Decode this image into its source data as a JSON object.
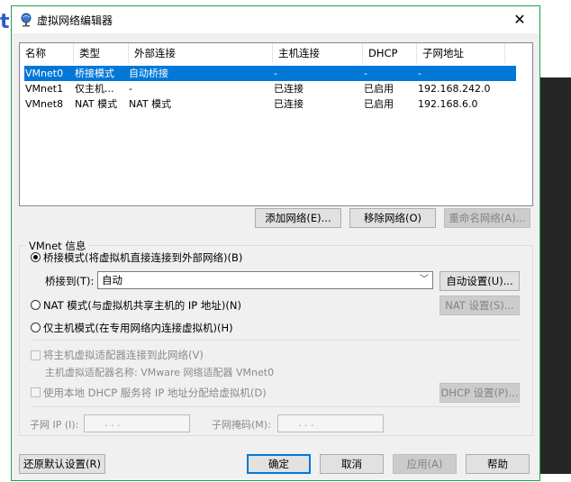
{
  "background": {
    "partial_letter": "t"
  },
  "dialog": {
    "title": "虚拟网络编辑器",
    "close_glyph": "✕"
  },
  "network_list": {
    "columns": [
      "名称",
      "类型",
      "外部连接",
      "主机连接",
      "DHCP",
      "子网地址"
    ],
    "rows": [
      {
        "name": "VMnet0",
        "type": "桥接模式",
        "external": "自动桥接",
        "host": "-",
        "dhcp": "-",
        "subnet": "-",
        "selected": true
      },
      {
        "name": "VMnet1",
        "type": "仅主机...",
        "external": "-",
        "host": "已连接",
        "dhcp": "已启用",
        "subnet": "192.168.242.0",
        "selected": false
      },
      {
        "name": "VMnet8",
        "type": "NAT 模式",
        "external": "NAT 模式",
        "host": "已连接",
        "dhcp": "已启用",
        "subnet": "192.168.6.0",
        "selected": false
      }
    ]
  },
  "list_buttons": {
    "add": "添加网络(E)...",
    "remove": "移除网络(O)",
    "rename": "重命名网络(A)..."
  },
  "vmnet_info": {
    "group_title": "VMnet 信息",
    "bridged_label": "桥接模式(将虚拟机直接连接到外部网络)(B)",
    "bridge_to_label": "桥接到(T):",
    "bridge_to_value": "自动",
    "auto_settings": "自动设置(U)...",
    "nat_label": "NAT 模式(与虚拟机共享主机的 IP 地址)(N)",
    "nat_settings": "NAT 设置(S)...",
    "hostonly_label": "仅主机模式(在专用网络内连接虚拟机)(H)",
    "connect_adapter_label": "将主机虚拟适配器连接到此网络(V)",
    "adapter_name_label": "主机虚拟适配器名称: VMware 网络适配器 VMnet0",
    "dhcp_label": "使用本地 DHCP 服务将 IP 地址分配给虚拟机(D)",
    "dhcp_settings": "DHCP 设置(P)...",
    "subnet_ip_label": "子网 IP (I):",
    "subnet_mask_label": "子网掩码(M):",
    "ip_placeholder": ".       .       .",
    "selected_mode": "bridged"
  },
  "footer": {
    "restore": "还原默认设置(R)",
    "ok": "确定",
    "cancel": "取消",
    "apply": "应用(A)",
    "help": "帮助"
  },
  "colors": {
    "selection": "#0078d7",
    "window_border": "#1aa34a",
    "dialog_bg": "#f0f0f0"
  }
}
